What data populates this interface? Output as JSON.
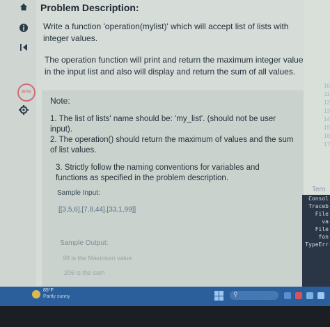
{
  "rail": {
    "home_icon": "home-icon",
    "info_icon": "info-icon",
    "collapse_icon": "collapse-icon",
    "badge_text": "80%",
    "settings_icon": "gear-icon"
  },
  "problem": {
    "heading": "Problem Description:",
    "intro": "Write a function 'operation(mylist)' which will accept list of lists with integer values.",
    "detail": "The operation function will print and return the maximum integer value in the input list and also will display and return the sum of all values."
  },
  "note": {
    "label": "Note:",
    "items": [
      "1. The list of lists' name should be: 'my_list'. (should not be user input).",
      "2. The operation() should return the maximum of values and the sum of list values.",
      "3. Strictly follow the naming conventions for variables and functions as specified in the problem description."
    ],
    "sample_input_label": "Sample Input:",
    "sample_input_value": "[[3,5,6],[7,8,44],[33,1,99]]",
    "sample_output_label": "Sample Output:",
    "sample_output_lines": [
      "99 is the Maximum value",
      "206 is the sum"
    ]
  },
  "editor": {
    "line_numbers": [
      "10",
      "11",
      "12",
      "13",
      "14",
      "15",
      "16",
      "17"
    ]
  },
  "terminal": {
    "title": "Tern",
    "lines": [
      "Consol",
      "Traceb",
      "File",
      "va",
      "File",
      "fon",
      "TypeErr"
    ]
  },
  "taskbar": {
    "temp": "85°F",
    "weather": "Partly sunny",
    "search_icon": "search-icon",
    "start_icon": "windows-icon"
  },
  "colors": {
    "taskbar": "#2a5f9c",
    "terminal_bg": "#2a3646",
    "badge": "#cf6b74"
  }
}
